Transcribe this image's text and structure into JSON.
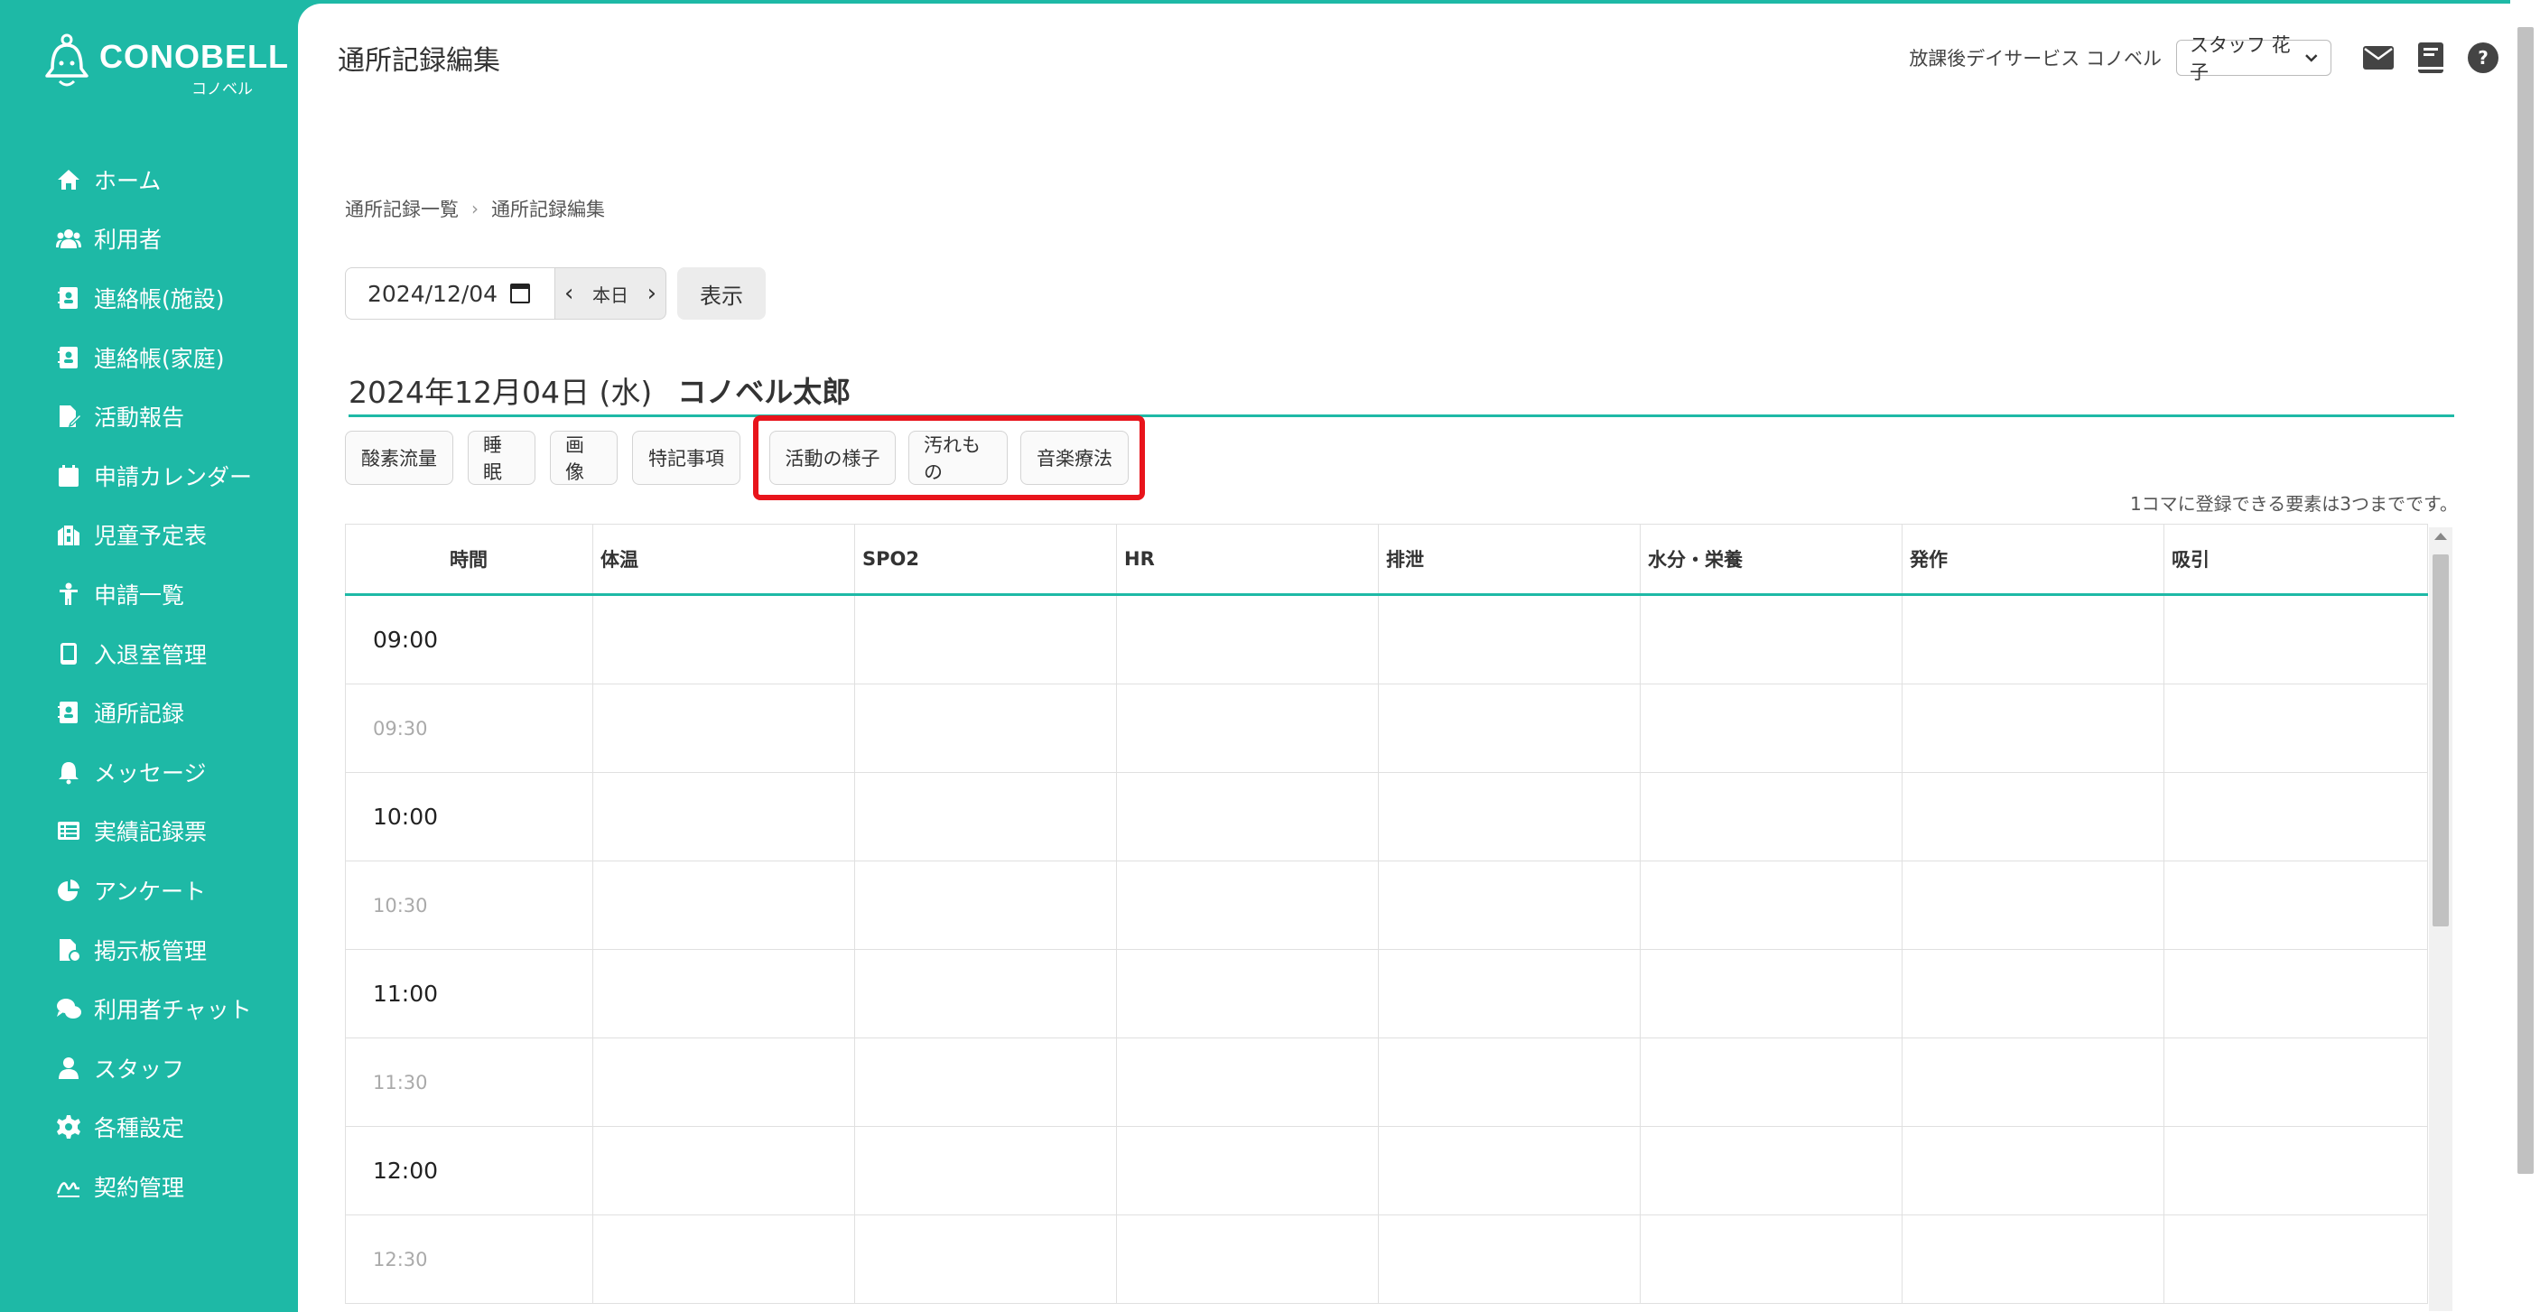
{
  "app": {
    "logo_text": "CONOBELL",
    "logo_sub": "コノベル"
  },
  "sidebar": {
    "items": [
      {
        "label": "ホーム",
        "icon": "home-icon"
      },
      {
        "label": "利用者",
        "icon": "users-icon"
      },
      {
        "label": "連絡帳(施設)",
        "icon": "contact-book-icon"
      },
      {
        "label": "連絡帳(家庭)",
        "icon": "contact-book-icon"
      },
      {
        "label": "活動報告",
        "icon": "report-icon"
      },
      {
        "label": "申請カレンダー",
        "icon": "calendar-icon"
      },
      {
        "label": "児童予定表",
        "icon": "building-icon"
      },
      {
        "label": "申請一覧",
        "icon": "child-icon"
      },
      {
        "label": "入退室管理",
        "icon": "tablet-icon"
      },
      {
        "label": "通所記録",
        "icon": "id-card-icon"
      },
      {
        "label": "メッセージ",
        "icon": "bell-icon"
      },
      {
        "label": "実績記録票",
        "icon": "table-icon"
      },
      {
        "label": "アンケート",
        "icon": "pie-chart-icon"
      },
      {
        "label": "掲示板管理",
        "icon": "board-icon"
      },
      {
        "label": "利用者チャット",
        "icon": "chat-icon"
      },
      {
        "label": "スタッフ",
        "icon": "staff-icon"
      },
      {
        "label": "各種設定",
        "icon": "gear-icon"
      },
      {
        "label": "契約管理",
        "icon": "signature-icon"
      }
    ]
  },
  "header": {
    "title": "通所記録編集",
    "facility": "放課後デイサービス コノベル",
    "staff_selected": "スタッフ 花子"
  },
  "breadcrumb": {
    "parent": "通所記録一覧",
    "current": "通所記録編集"
  },
  "date_controls": {
    "date_value": "2024/12/04",
    "today_label": "本日",
    "show_label": "表示"
  },
  "record": {
    "date_text": "2024年12月04日 (水)",
    "name": "コノベル太郎"
  },
  "tags": {
    "primary": [
      "酸素流量",
      "睡眠",
      "画像",
      "特記事項"
    ],
    "highlighted": [
      "活動の様子",
      "汚れもの",
      "音楽療法"
    ],
    "highlight_color": "#e8141b"
  },
  "limit_note": "1コマに登録できる要素は3つまでです。",
  "table": {
    "headers": [
      "時間",
      "体温",
      "SPO2",
      "HR",
      "排泄",
      "水分・栄養",
      "発作",
      "吸引"
    ],
    "times": [
      "09:00",
      "09:30",
      "10:00",
      "10:30",
      "11:00",
      "11:30",
      "12:00",
      "12:30"
    ]
  },
  "colors": {
    "accent": "#1eb9a6",
    "highlight": "#e8141b"
  }
}
